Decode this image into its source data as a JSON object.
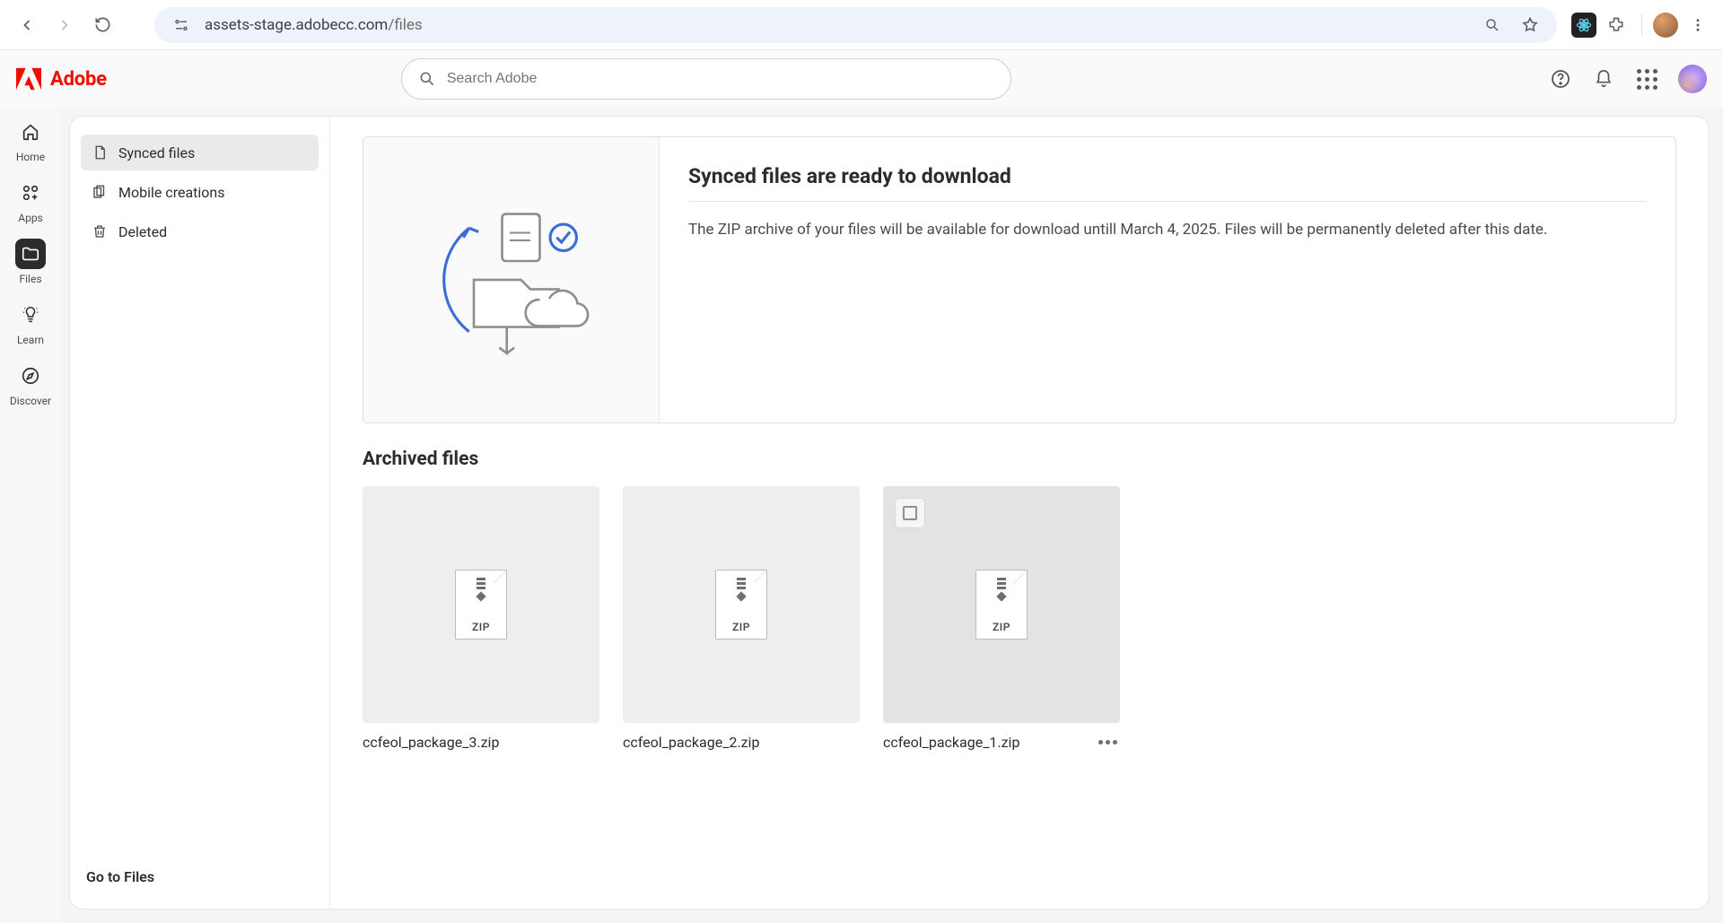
{
  "browser": {
    "url_host": "assets-stage.adobecc.com",
    "url_path": "/files"
  },
  "header": {
    "brand": "Adobe",
    "search_placeholder": "Search Adobe"
  },
  "left_rail": [
    {
      "id": "home",
      "label": "Home",
      "active": false
    },
    {
      "id": "apps",
      "label": "Apps",
      "active": false
    },
    {
      "id": "files",
      "label": "Files",
      "active": true
    },
    {
      "id": "learn",
      "label": "Learn",
      "active": false
    },
    {
      "id": "discover",
      "label": "Discover",
      "active": false
    }
  ],
  "side_nav": {
    "items": [
      {
        "id": "synced",
        "label": "Synced files",
        "active": true
      },
      {
        "id": "mobile",
        "label": "Mobile creations",
        "active": false
      },
      {
        "id": "deleted",
        "label": "Deleted",
        "active": false
      }
    ],
    "footer_link": "Go to Files"
  },
  "banner": {
    "title": "Synced files are ready to download",
    "description": "The ZIP archive of your files will be available for download untill March 4, 2025. Files will be permanently deleted after this date."
  },
  "archive_section": {
    "title": "Archived files",
    "files": [
      {
        "name": "ccfeol_package_3.zip",
        "type": "ZIP",
        "hover": false,
        "show_more": false
      },
      {
        "name": "ccfeol_package_2.zip",
        "type": "ZIP",
        "hover": false,
        "show_more": false
      },
      {
        "name": "ccfeol_package_1.zip",
        "type": "ZIP",
        "hover": true,
        "show_more": true
      }
    ]
  }
}
